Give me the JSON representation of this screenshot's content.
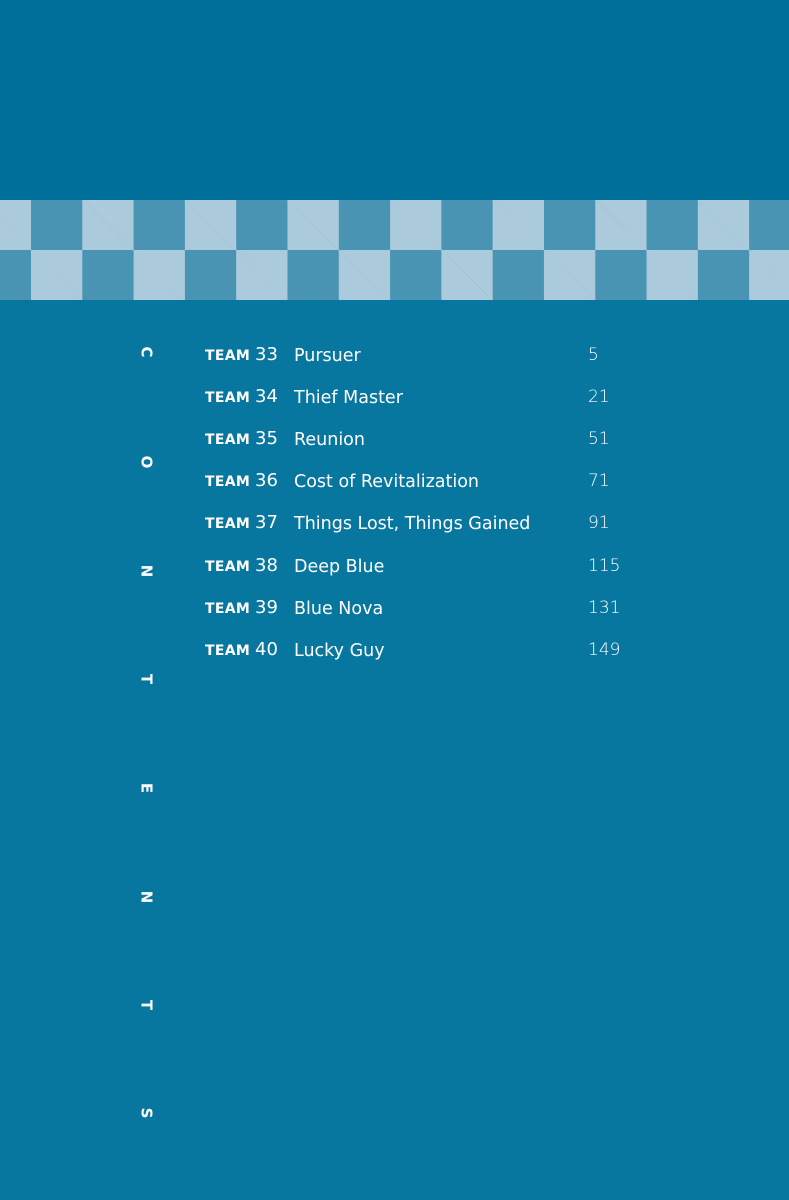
{
  "contents_heading": [
    "C",
    "O",
    "N",
    "T",
    "E",
    "N",
    "T",
    "S"
  ],
  "toc": [
    {
      "team_label": "TEAM",
      "number": "33",
      "title": "Pursuer",
      "page": "5"
    },
    {
      "team_label": "TEAM",
      "number": "34",
      "title": "Thief Master",
      "page": "21"
    },
    {
      "team_label": "TEAM",
      "number": "35",
      "title": "Reunion",
      "page": "51"
    },
    {
      "team_label": "TEAM",
      "number": "36",
      "title": "Cost of Revitalization",
      "page": "71"
    },
    {
      "team_label": "TEAM",
      "number": "37",
      "title": "Things Lost, Things Gained",
      "page": "91"
    },
    {
      "team_label": "TEAM",
      "number": "38",
      "title": "Deep Blue",
      "page": "115"
    },
    {
      "team_label": "TEAM",
      "number": "39",
      "title": "Blue Nova",
      "page": "131"
    },
    {
      "team_label": "TEAM",
      "number": "40",
      "title": "Lucky Guy",
      "page": "149"
    }
  ],
  "colors": {
    "background": "#0877a0",
    "top_band": "#00709a",
    "checker_dark": "#4a94b3",
    "checker_light": "#abcbdd",
    "text": "#ffffff"
  }
}
